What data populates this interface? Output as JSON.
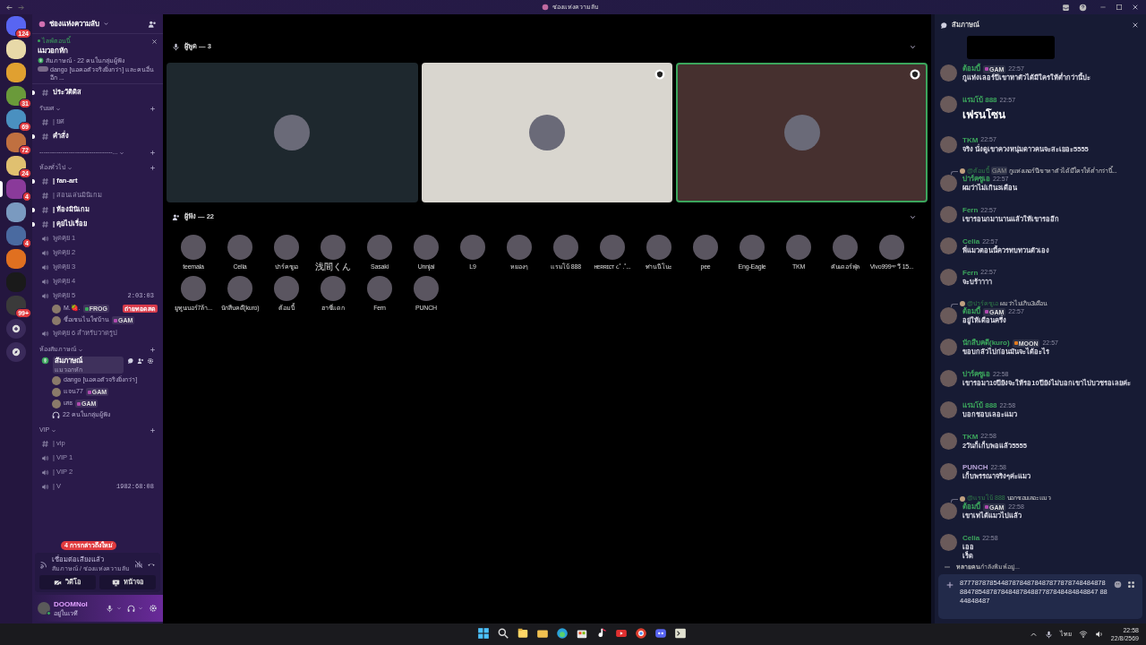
{
  "window": {
    "title": "ช่องแห่งความลับ"
  },
  "servers": [
    {
      "badge": "124",
      "selected": false,
      "color": "#5865f2"
    },
    {
      "selected": false,
      "color": "#e8d9a8"
    },
    {
      "selected": false,
      "color": "#e0a030"
    },
    {
      "badge": "31",
      "selected": false,
      "color": "#6a9a3a"
    },
    {
      "badge": "69",
      "selected": false,
      "color": "#4a90c0"
    },
    {
      "badge": "72",
      "selected": false,
      "color": "#c07040"
    },
    {
      "badge": "24",
      "selected": false,
      "color": "#e0c070"
    },
    {
      "badge": "4",
      "selected": true,
      "color": "#8a3a9a"
    },
    {
      "selected": false,
      "color": "#7a9ac0"
    },
    {
      "badge": "4",
      "selected": false,
      "color": "#4a6aa0"
    },
    {
      "selected": false,
      "color": "#e07020"
    },
    {
      "selected": false,
      "color": "#1a1a1a"
    },
    {
      "badge": "99+",
      "selected": false,
      "color": "#3a3a3a"
    }
  ],
  "sidebar": {
    "server_name": "ช่องแห่งความลับ",
    "live": {
      "label": "ไลฟ์ตอนนี้",
      "title": "แมวอกหัก",
      "meta": "สัมภาษณ์ · 22 คนในกลุ่มผู้ฟัง",
      "speakers": "dango [นอคอตัวจริงยิ่งกว่า] และคนอื่นอีก ..."
    },
    "channels": [
      {
        "kind": "text",
        "name": "ประวัติดิส",
        "unread": true
      },
      {
        "kind": "category",
        "name": "รับยศ"
      },
      {
        "kind": "text",
        "name": "| ยศ",
        "unread": false
      },
      {
        "kind": "text",
        "name": "คำสั่ง",
        "unread": true
      },
      {
        "kind": "divider",
        "name": "-----------------------------------..."
      },
      {
        "kind": "category",
        "name": "ห้องทั่วไป"
      },
      {
        "kind": "text",
        "name": "| fan-art",
        "unread": true
      },
      {
        "kind": "text",
        "name": "| สอนเล่นมินิเกม",
        "unread": false
      },
      {
        "kind": "text",
        "name": "| ห้องมินิเกม",
        "unread": true
      },
      {
        "kind": "text",
        "name": "| คุยไปเรื่อย",
        "unread": true
      },
      {
        "kind": "voice",
        "name": "พูดคุย 1"
      },
      {
        "kind": "voice",
        "name": "พูดคุย 2"
      },
      {
        "kind": "voice",
        "name": "พูดคุย 3"
      },
      {
        "kind": "voice",
        "name": "พูดคุย 4"
      },
      {
        "kind": "voice",
        "name": "พูดคุย 5",
        "timer": "2:03:03",
        "users": [
          {
            "name": "M.🍓.",
            "tag": {
              "label": "FROG",
              "color": "#3ba55c"
            },
            "live": "ถ่ายทอดสด"
          },
          {
            "name": "ชื่อเซนไนใช่บ้าน",
            "tag": {
              "label": "GAM",
              "color": "#b04ab0"
            }
          }
        ]
      },
      {
        "kind": "voice",
        "name": "พูดคุย 6 สำหรับวาดรูป"
      },
      {
        "kind": "category",
        "name": "ห้องสัมภาษณ์"
      },
      {
        "kind": "stage",
        "name": "สัมภาษณ์",
        "subtitle": "แมวอกหัก",
        "selected": true,
        "users": [
          {
            "name": "dango [นอคอตัวจริงยิ่งกว่า]"
          },
          {
            "name": "แจน77",
            "tag": {
              "label": "GAM",
              "color": "#b04ab0"
            }
          },
          {
            "name": "เสธ",
            "tag": {
              "label": "GAM",
              "color": "#b04ab0"
            }
          }
        ],
        "audience": "22 คนในกลุ่มผู้ฟัง"
      },
      {
        "kind": "category",
        "name": "VIP"
      },
      {
        "kind": "text",
        "name": "| vip",
        "unread": false
      },
      {
        "kind": "voice",
        "name": "| VIP 1"
      },
      {
        "kind": "voice",
        "name": "| VIP 2"
      },
      {
        "kind": "voice",
        "name": "| V",
        "timer": "1982:68:08"
      }
    ],
    "mentions": "4 การกล่าวถึงใหม่",
    "voice_panel": {
      "status": "เชื่อมต่อเสียงแล้ว",
      "location": "สัมภาษณ์ / ช่องแห่งความลับ",
      "buttons": [
        "วิดีโอ",
        "หน้าจอ"
      ]
    },
    "user": {
      "name": "DOOMNoI",
      "status": "อยู่ในเวที"
    }
  },
  "stage": {
    "speakers_header": "ผู้พูด — 3",
    "speakers": [
      {
        "color": "#1e282e",
        "selected": false
      },
      {
        "color": "#d9d6cf",
        "selected": false
      },
      {
        "color": "#46302f",
        "selected": true
      }
    ],
    "audience_header": "ผู้ฟัง — 22",
    "listeners": [
      "teemala",
      "Celia",
      "ปาร์คซูเอ",
      "浅間くん",
      "Sasaki",
      "Unnjai",
      "L9",
      "หยองๆ",
      "แรมโบ้ 888",
      "ʜᴇʀʀɪᴄᴛ ૮˚ .˚...",
      "ท่านนีโนะ",
      "pee",
      "Eng-Eagle",
      "TKM",
      "คันเดอร์ฟุ่ล",
      "Vivo999ᵒᵖ วี 15...",
      "ยูทูบเบอร์7ล้า...",
      "นักสืบคดี(kuro)",
      "ต้อมบี้",
      "ฮาชี่แดก",
      "Fern",
      "PUNCH"
    ]
  },
  "chat": {
    "title": "สัมภาษณ์",
    "messages": [
      {
        "kind": "text",
        "author": "ต้อมบี้",
        "color": "#3ba55c",
        "tag": {
          "label": "GAM",
          "color": "#b04ab0"
        },
        "time": "22:57",
        "lines": [
          "กูแห่งเลอร์ปีเขาหาตัวได้มีใครให้ต่ำกว่านี้ปะ"
        ]
      },
      {
        "kind": "large",
        "author": "แรมโบ้ 888",
        "color": "#3ba55c",
        "time": "22:57",
        "lines": [
          "เฟรนโซน"
        ]
      },
      {
        "kind": "text",
        "author": "TKM",
        "color": "#3ba55c",
        "time": "22:57",
        "lines": [
          "จริง นั่งดูเขาควงหนุ่มดาวคนจะสะเยอะ5555"
        ]
      },
      {
        "kind": "text",
        "author": "ปาร์คซูเอ",
        "color": "#3ba55c",
        "time": "22:57",
        "reply": {
          "author": "@ต้อมบี้",
          "tag": "GAM",
          "text": "กูแห่งเลอร์ปีเขาหาตัวได้มีใครให้ต่ำกว่านี้..."
        },
        "lines": [
          "ผมว่าไม่เกิน3เดือน"
        ]
      },
      {
        "kind": "text",
        "author": "Fern",
        "color": "#3ba55c",
        "time": "22:57",
        "lines": [
          "เขารอนกมานานแล้วให้เขารออีก"
        ]
      },
      {
        "kind": "text",
        "author": "Celia",
        "color": "#3ba55c",
        "time": "22:57",
        "lines": [
          "พี่แมวตอนนี้ควรทบทวนตัวเอง"
        ]
      },
      {
        "kind": "text",
        "author": "Fern",
        "color": "#3ba55c",
        "time": "22:57",
        "lines": [
          "จะบร้าาาา"
        ]
      },
      {
        "kind": "text",
        "author": "ต้อมบี้",
        "color": "#3ba55c",
        "tag": {
          "label": "GAM",
          "color": "#b04ab0"
        },
        "time": "22:57",
        "reply": {
          "author": "@ปาร์คซูเอ",
          "text": "ผมว่าไม่เกิน3เดือน"
        },
        "lines": [
          "อยู่ให้เดือนครึ่ง"
        ]
      },
      {
        "kind": "text",
        "author": "นักสืบคดี(kuro)",
        "color": "#3ba55c",
        "tag": {
          "label": "MOON",
          "color": "#e07a20"
        },
        "time": "22:57",
        "lines": [
          "ขอบกลัวไปก่อนมันจะได้อะไร"
        ]
      },
      {
        "kind": "text",
        "author": "ปาร์คซูเอ",
        "color": "#3ba55c",
        "time": "22:58",
        "lines": [
          "เขารอมา10ปียังจะให้รอ10ปียังไม่บอกเขาไปบวชรอเลยค่ะ"
        ]
      },
      {
        "kind": "text",
        "author": "แรมโบ้ 888",
        "color": "#3ba55c",
        "time": "22:58",
        "lines": [
          "บอกชอบเลอะแมว"
        ]
      },
      {
        "kind": "text",
        "author": "TKM",
        "color": "#3ba55c",
        "time": "22:58",
        "lines": [
          "2วันก็เก็บพอแล้ว5555"
        ]
      },
      {
        "kind": "text",
        "author": "PUNCH",
        "color": "#b8a4d8",
        "time": "22:58",
        "lines": [
          "เก็บพรรณาจริงๆค่ะแมว"
        ]
      },
      {
        "kind": "text",
        "author": "ต้อมบี้",
        "color": "#3ba55c",
        "tag": {
          "label": "GAM",
          "color": "#b04ab0"
        },
        "time": "22:58",
        "reply": {
          "author": "@แรมโบ้ 888",
          "text": "บอกชอบเลอะแมว"
        },
        "lines": [
          "เขาเทได้แมวไปแล้ว"
        ]
      },
      {
        "kind": "text",
        "author": "Celia",
        "color": "#3ba55c",
        "time": "22:58",
        "lines": [
          "เออ",
          "เร็ด"
        ]
      }
    ],
    "typing": "**หลายคน**กำลังพิมพ์อยู่...",
    "input": {
      "value": "8777878785448787848784878778787484848788847854878784848784887787848484848847 8844848487"
    }
  },
  "taskbar": {
    "language": "ไทย",
    "time": "22:58",
    "date": "22/8/2569"
  }
}
